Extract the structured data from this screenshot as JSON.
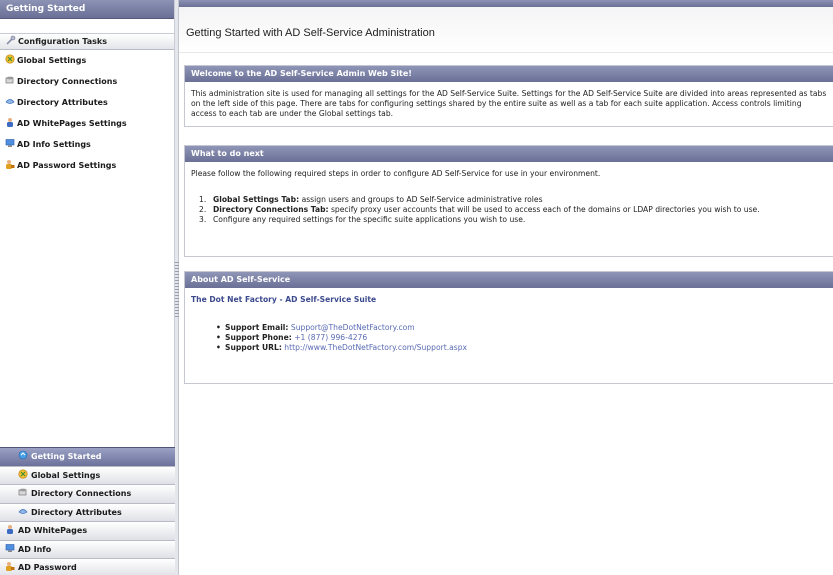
{
  "left": {
    "title": "Getting Started",
    "section": "Configuration Tasks",
    "tasks": [
      {
        "label": "Global Settings",
        "icon": "globe-icon"
      },
      {
        "label": "Directory Connections",
        "icon": "server-icon"
      },
      {
        "label": "Directory Attributes",
        "icon": "attributes-icon"
      },
      {
        "label": "AD WhitePages Settings",
        "icon": "person-icon"
      },
      {
        "label": "AD Info Settings",
        "icon": "computer-icon"
      },
      {
        "label": "AD Password Settings",
        "icon": "key-person-icon"
      }
    ],
    "tabs": [
      {
        "label": "Getting Started",
        "icon": "getting-started-icon"
      },
      {
        "label": "Global Settings",
        "icon": "globe-icon"
      },
      {
        "label": "Directory Connections",
        "icon": "server-icon"
      },
      {
        "label": "Directory Attributes",
        "icon": "attributes-icon"
      },
      {
        "label": "AD WhitePages",
        "icon": "person-icon"
      },
      {
        "label": "AD Info",
        "icon": "computer-icon"
      },
      {
        "label": "AD Password",
        "icon": "key-person-icon"
      }
    ]
  },
  "main": {
    "title": "Getting Started with AD Self-Service Administration",
    "welcome": {
      "header": "Welcome to the AD Self-Service Admin Web Site!",
      "body": "This administration site is used for managing all settings for the AD Self-Service Suite. Settings for the AD Self-Service Suite are divided into areas represented as tabs on the left side of this page. There are tabs for configuring settings shared by the entire suite as well as a tab for each suite application. Access controls limiting access to each tab are under the Global settings tab."
    },
    "next": {
      "header": "What to do next",
      "intro": "Please follow the following required steps in order to configure AD Self-Service for use in your environment.",
      "steps": [
        {
          "num": "1.",
          "bold": "Global Settings Tab:",
          "text": " assign users and groups to AD Self-Service administrative roles"
        },
        {
          "num": "2.",
          "bold": "Directory Connections Tab:",
          "text": " specify proxy user accounts that will be used to access each of the domains or LDAP directories you wish to use."
        },
        {
          "num": "3.",
          "bold": "",
          "text": "Configure any required settings for the specific suite applications you wish to use."
        }
      ]
    },
    "about": {
      "header": "About AD Self-Service",
      "subtitle": "The Dot Net Factory - AD Self-Service Suite",
      "contacts": [
        {
          "label": "Support Email:",
          "value": "Support@TheDotNetFactory.com"
        },
        {
          "label": "Support Phone:",
          "value": "+1 (877) 996-4276"
        },
        {
          "label": "Support URL:",
          "value": "http://www.TheDotNetFactory.com/Support.aspx"
        }
      ]
    }
  },
  "colors": {
    "header_gradient_top": "#8d93b5",
    "header_gradient_bottom": "#6a7096",
    "link": "#5a6bb3",
    "subtitle": "#3c4a8e"
  }
}
